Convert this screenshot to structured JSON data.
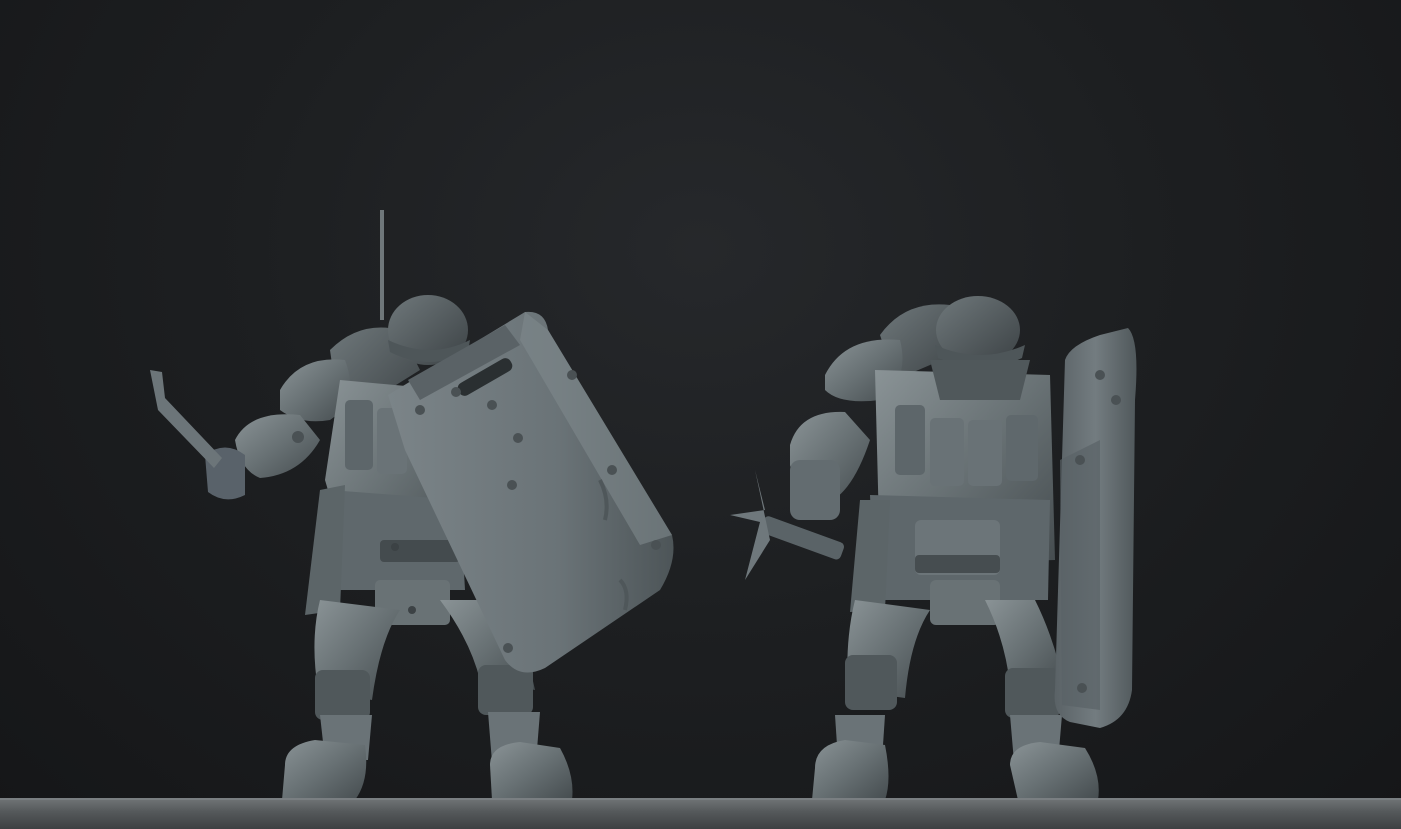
{
  "scene": {
    "background_color": "#1b1d1f",
    "model_color": "#6b7478",
    "ground_color": "#5c6062",
    "figures": [
      {
        "name": "left-soldier",
        "weapon": "machete",
        "shield": "large-riveted-shield"
      },
      {
        "name": "right-soldier",
        "weapon": "hatchet",
        "shield": "tall-narrow-shield"
      }
    ]
  }
}
